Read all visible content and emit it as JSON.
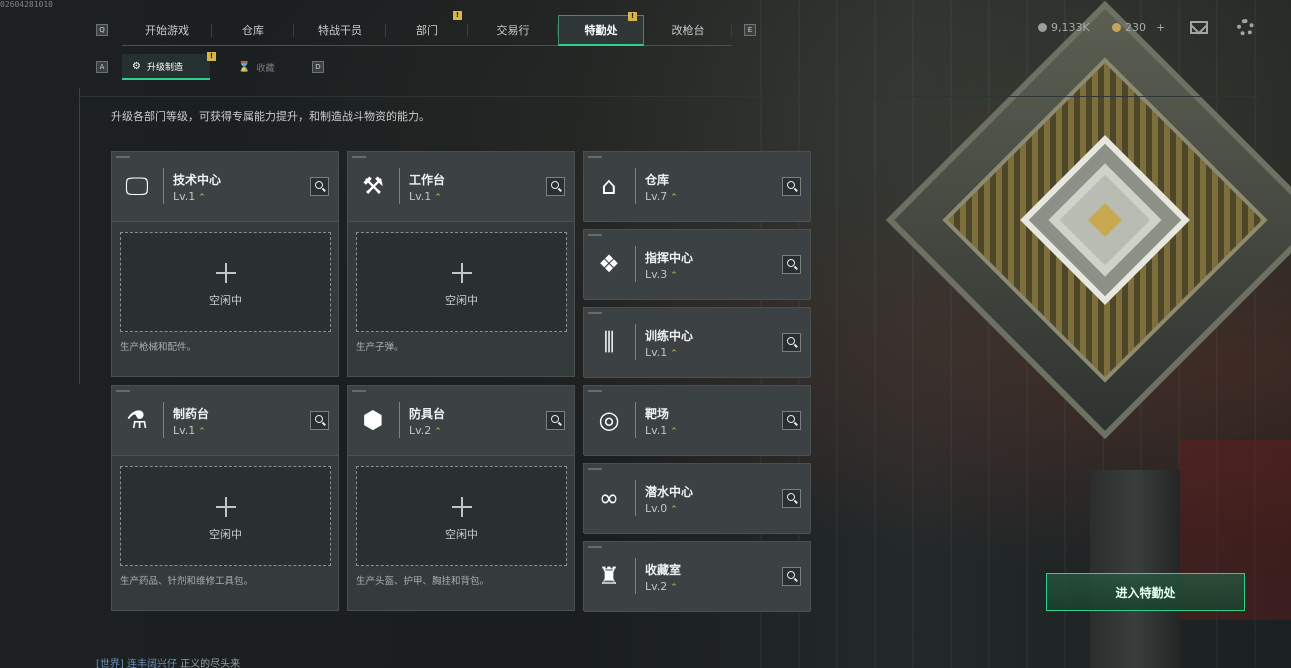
{
  "session_counter": "02604281010",
  "nav": {
    "left_key": "Q",
    "right_key": "E",
    "tabs": [
      {
        "label": "开始游戏",
        "badge": ""
      },
      {
        "label": "仓库",
        "badge": ""
      },
      {
        "label": "特战干员",
        "badge": ""
      },
      {
        "label": "部门",
        "badge": "!"
      },
      {
        "label": "交易行",
        "badge": ""
      },
      {
        "label": "特勤处",
        "badge": "!",
        "active": true
      },
      {
        "label": "改枪台",
        "badge": ""
      }
    ]
  },
  "subnav": {
    "left_key": "A",
    "right_key": "D",
    "tabs": [
      {
        "label": "升级制造",
        "icon": "upgrade-icon",
        "badge": "!",
        "active": true
      },
      {
        "label": "收藏",
        "icon": "collection-icon",
        "badge": ""
      }
    ]
  },
  "currency": {
    "coins": "9,133K",
    "premium": "230",
    "premium_plus": "+"
  },
  "description": "升级各部门等级，可获得专属能力提升，和制造战斗物资的能力。",
  "slot_idle_label": "空闲中",
  "large_cards": [
    {
      "name": "技术中心",
      "level": "Lv.1",
      "icon": "monitor-icon",
      "desc": "生产枪械和配件。"
    },
    {
      "name": "工作台",
      "level": "Lv.1",
      "icon": "tools-icon",
      "desc": "生产子弹。"
    },
    {
      "name": "制药台",
      "level": "Lv.1",
      "icon": "microscope-icon",
      "desc": "生产药品、针剂和维修工具包。"
    },
    {
      "name": "防具台",
      "level": "Lv.2",
      "icon": "armor-icon",
      "desc": "生产头盔、护甲、胸挂和背包。"
    }
  ],
  "small_cards": [
    {
      "name": "仓库",
      "level": "Lv.7",
      "icon": "warehouse-icon"
    },
    {
      "name": "指挥中心",
      "level": "Lv.3",
      "icon": "chip-icon"
    },
    {
      "name": "训练中心",
      "level": "Lv.1",
      "icon": "dumbbell-icon"
    },
    {
      "name": "靶场",
      "level": "Lv.1",
      "icon": "target-icon"
    },
    {
      "name": "潜水中心",
      "level": "Lv.0",
      "icon": "diving-mask-icon"
    },
    {
      "name": "收藏室",
      "level": "Lv.2",
      "icon": "trophy-icon"
    }
  ],
  "enter_button": "进入特勤处",
  "chat": {
    "channel": "[世界]",
    "sender": "连丰阔兴仔",
    "message": "正义的尽头来"
  },
  "colors": {
    "accent": "#2fd08a",
    "level_chevron": "#d8b54a",
    "badge": "#d8b54a"
  }
}
